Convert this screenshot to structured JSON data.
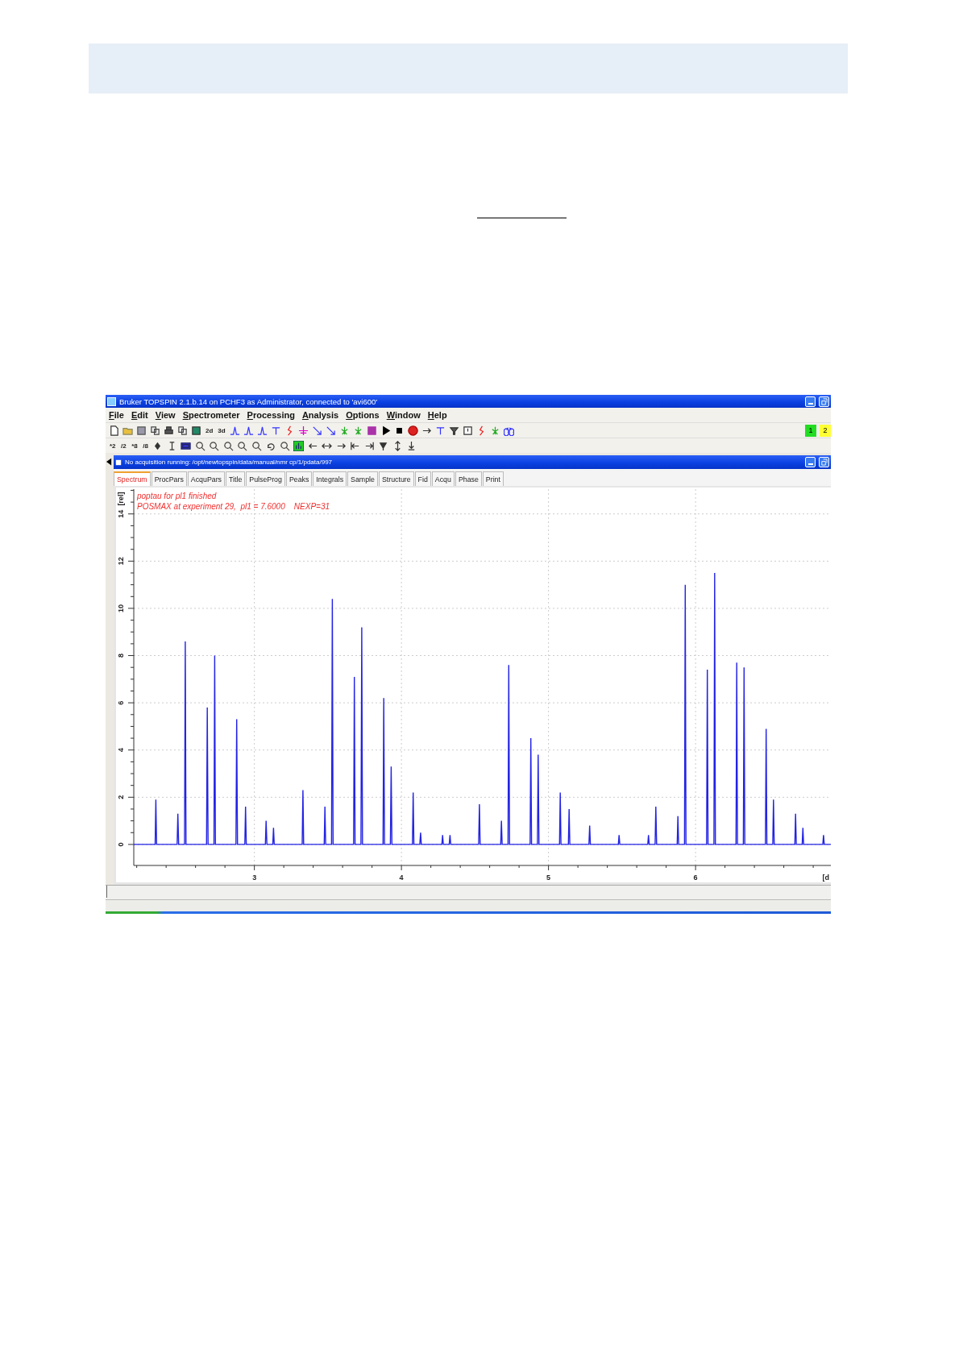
{
  "window": {
    "title": "Bruker TOPSPIN 2.1.b.14 on PCHF3 as Administrator, connected to 'avi600'"
  },
  "menu": [
    "File",
    "Edit",
    "View",
    "Spectrometer",
    "Processing",
    "Analysis",
    "Options",
    "Window",
    "Help"
  ],
  "toolbar_1": {
    "buttons": [
      "2d",
      "3d"
    ],
    "indicators": [
      {
        "label": "1",
        "color": "#22dd22"
      },
      {
        "label": "2",
        "color": "#ffff33"
      }
    ]
  },
  "toolbar_2": {
    "buttons": [
      "*2",
      "/2",
      "*8",
      "/8"
    ]
  },
  "data_window": {
    "title": "No acquisition running: /opt/newtopspin/data/manual/nmr cp/1/pdata/997",
    "tabs": [
      {
        "label": "Spectrum",
        "selected": true
      },
      {
        "label": "ProcPars",
        "selected": false
      },
      {
        "label": "AcquPars",
        "selected": false
      },
      {
        "label": "Title",
        "selected": false
      },
      {
        "label": "PulseProg",
        "selected": false
      },
      {
        "label": "Peaks",
        "selected": false
      },
      {
        "label": "Integrals",
        "selected": false
      },
      {
        "label": "Sample",
        "selected": false
      },
      {
        "label": "Structure",
        "selected": false
      },
      {
        "label": "Fid",
        "selected": false
      },
      {
        "label": "Acqu",
        "selected": false
      },
      {
        "label": "Phase",
        "selected": false
      },
      {
        "label": "Print",
        "selected": false
      }
    ],
    "messages": [
      "poptau for pl1 finished",
      "POSMAX at experiment 29,  pl1 = 7.6000    NEXP=31"
    ],
    "chart_data": {
      "type": "line",
      "grid": true,
      "xlabel": "[d",
      "ylabel": "[rel]",
      "xlim": [
        2.18,
        6.92
      ],
      "ylim": [
        -0.89,
        15.05
      ],
      "xticks": [
        3,
        4,
        5,
        6
      ],
      "yticks": [
        0,
        2,
        4,
        6,
        8,
        10,
        12,
        14
      ],
      "x": [
        2.18,
        2.325,
        2.33,
        2.335,
        2.475,
        2.48,
        2.485,
        2.525,
        2.53,
        2.535,
        2.675,
        2.68,
        2.685,
        2.725,
        2.73,
        2.735,
        2.875,
        2.88,
        2.885,
        2.935,
        2.94,
        2.945,
        3.075,
        3.08,
        3.085,
        3.125,
        3.13,
        3.135,
        3.325,
        3.33,
        3.335,
        3.475,
        3.48,
        3.485,
        3.525,
        3.53,
        3.535,
        3.675,
        3.68,
        3.685,
        3.725,
        3.73,
        3.735,
        3.875,
        3.88,
        3.885,
        3.925,
        3.93,
        3.935,
        4.075,
        4.08,
        4.085,
        4.125,
        4.13,
        4.135,
        4.275,
        4.28,
        4.285,
        4.325,
        4.33,
        4.335,
        4.525,
        4.53,
        4.535,
        4.675,
        4.68,
        4.685,
        4.725,
        4.73,
        4.735,
        4.875,
        4.88,
        4.885,
        4.925,
        4.93,
        4.935,
        5.075,
        5.08,
        5.085,
        5.135,
        5.14,
        5.145,
        5.275,
        5.28,
        5.285,
        5.475,
        5.48,
        5.485,
        5.675,
        5.68,
        5.685,
        5.725,
        5.73,
        5.735,
        5.875,
        5.88,
        5.885,
        5.925,
        5.93,
        5.935,
        6.075,
        6.08,
        6.085,
        6.125,
        6.13,
        6.135,
        6.275,
        6.28,
        6.285,
        6.325,
        6.33,
        6.335,
        6.475,
        6.48,
        6.485,
        6.525,
        6.53,
        6.535,
        6.675,
        6.68,
        6.685,
        6.725,
        6.73,
        6.735,
        6.865,
        6.87,
        6.875,
        6.92
      ],
      "series": [
        {
          "color": "#2323e6",
          "values": [
            0,
            0,
            1.9,
            0,
            0,
            1.3,
            0,
            0,
            8.6,
            0,
            0,
            5.8,
            0,
            0,
            8.0,
            0,
            0,
            5.3,
            0,
            0,
            1.6,
            0,
            0,
            1.0,
            0,
            0,
            0.7,
            0,
            0,
            2.3,
            0,
            0,
            1.6,
            0,
            0,
            10.4,
            0,
            0,
            7.1,
            0,
            0,
            9.2,
            0,
            0,
            6.2,
            0,
            0,
            3.3,
            0,
            0,
            2.2,
            0,
            0,
            0.5,
            0,
            0,
            0.4,
            0,
            0,
            0.4,
            0,
            0,
            1.7,
            0,
            0,
            1.0,
            0,
            0,
            7.6,
            0,
            0,
            4.5,
            0,
            0,
            3.8,
            0,
            0,
            2.2,
            0,
            0,
            1.5,
            0,
            0,
            0.8,
            0,
            0,
            0.4,
            0,
            0,
            0.4,
            0,
            0,
            1.6,
            0,
            0,
            1.2,
            0,
            0,
            11.0,
            0,
            0,
            7.4,
            0,
            0,
            11.5,
            0,
            0,
            7.7,
            0,
            0,
            7.5,
            0,
            0,
            4.9,
            0,
            0,
            1.9,
            0,
            0,
            1.3,
            0,
            0,
            0.7,
            0,
            0,
            0.4,
            0,
            0
          ]
        }
      ]
    }
  }
}
